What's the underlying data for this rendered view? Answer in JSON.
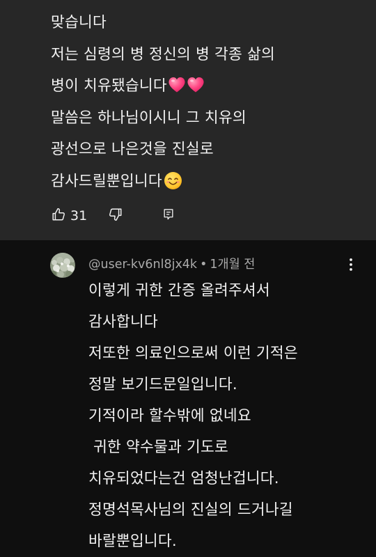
{
  "comment": {
    "lines": [
      "맞습니다",
      "저는 심령의 병 정신의 병 각종 삶의",
      "병이 치유됐습니다",
      "말씀은 하나님이시니 그 치유의",
      "광선으로 나은것을 진실로",
      "감사드릴뿐입니다"
    ],
    "emoji_line3": [
      "heart-emoji",
      "heart-emoji"
    ],
    "emoji_line6": "smiling-face-emoji",
    "like_count": "31",
    "icons": {
      "like": "thumbs-up-icon",
      "dislike": "thumbs-down-icon",
      "reply": "reply-icon"
    }
  },
  "reply": {
    "author": "@user-kv6nl8jx4k",
    "separator": "•",
    "time": "1개월 전",
    "avatar": "avatar",
    "more_icon": "more-vert-icon",
    "lines": [
      "이렇게 귀한 간증 올려주셔서",
      "감사합니다",
      "저또한 의료인으로써 이런 기적은",
      "정말 보기드문일입니다.",
      "기적이라 할수밖에 없네요",
      " 귀한 약수물과 기도로",
      "치유되었다는건 엄청난겁니다.",
      "정명석목사님의 진실의 드거나길",
      "바랄뿐입니다."
    ]
  },
  "colors": {
    "top_bg": "#272727",
    "page_bg": "#0f0f0f",
    "text": "#f1f1f1",
    "meta": "#aaaaaa",
    "heart": "#ff3d7f"
  }
}
